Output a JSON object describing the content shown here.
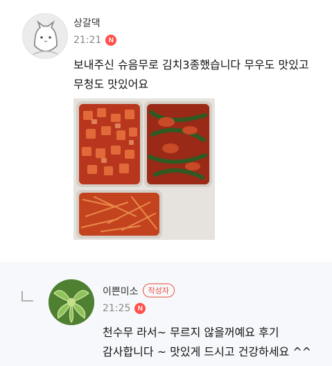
{
  "comments": [
    {
      "author": "상갈댁",
      "time": "21:21",
      "new_badge": "N",
      "text_line1": "보내주신 슈음무로 김치3종했습니다 무우도 맛있고",
      "text_line2": "무청도 맛있어요",
      "avatar_icon": "cat-face-avatar",
      "has_photo": true
    },
    {
      "author": "이쁜미소",
      "writer_badge": "작성자",
      "time": "21:25",
      "new_badge": "N",
      "text_line1": "천수무 라서~ 무르지 않을꺼예요 후기",
      "text_line2": "감사합니다 ~ 맛있게 드시고 건강하세요 ^^",
      "avatar_icon": "lettuce-avatar",
      "is_reply": true
    }
  ],
  "colors": {
    "badge_red": "#ff4f48",
    "writer_badge": "#e9523e",
    "reply_bg": "#f7f8fb"
  }
}
